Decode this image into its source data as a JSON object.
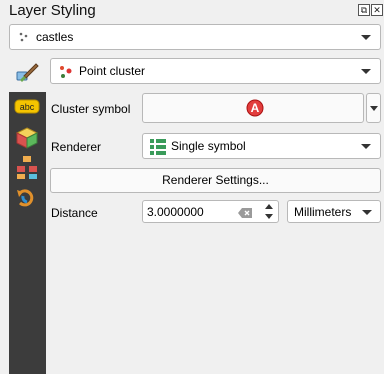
{
  "panel": {
    "title": "Layer Styling",
    "float_icon": "float-icon",
    "close_icon": "close-icon"
  },
  "layer_select": {
    "value": "castles",
    "icon": "point-layer-icon"
  },
  "renderer_type": {
    "value": "Point cluster",
    "icon": "point-cluster-icon"
  },
  "sidebar": {
    "icons": [
      "symbology-brush-icon",
      "labels-abc-icon",
      "3d-view-icon",
      "diagrams-icon",
      "history-icon"
    ]
  },
  "cluster_symbol": {
    "label": "Cluster symbol",
    "marker_letter": "A",
    "marker_color": "#e23d3d"
  },
  "renderer": {
    "label": "Renderer",
    "value": "Single symbol",
    "icon": "single-symbol-icon"
  },
  "renderer_settings": {
    "label": "Renderer Settings..."
  },
  "distance": {
    "label": "Distance",
    "value": "3.0000000",
    "unit": "Millimeters"
  }
}
